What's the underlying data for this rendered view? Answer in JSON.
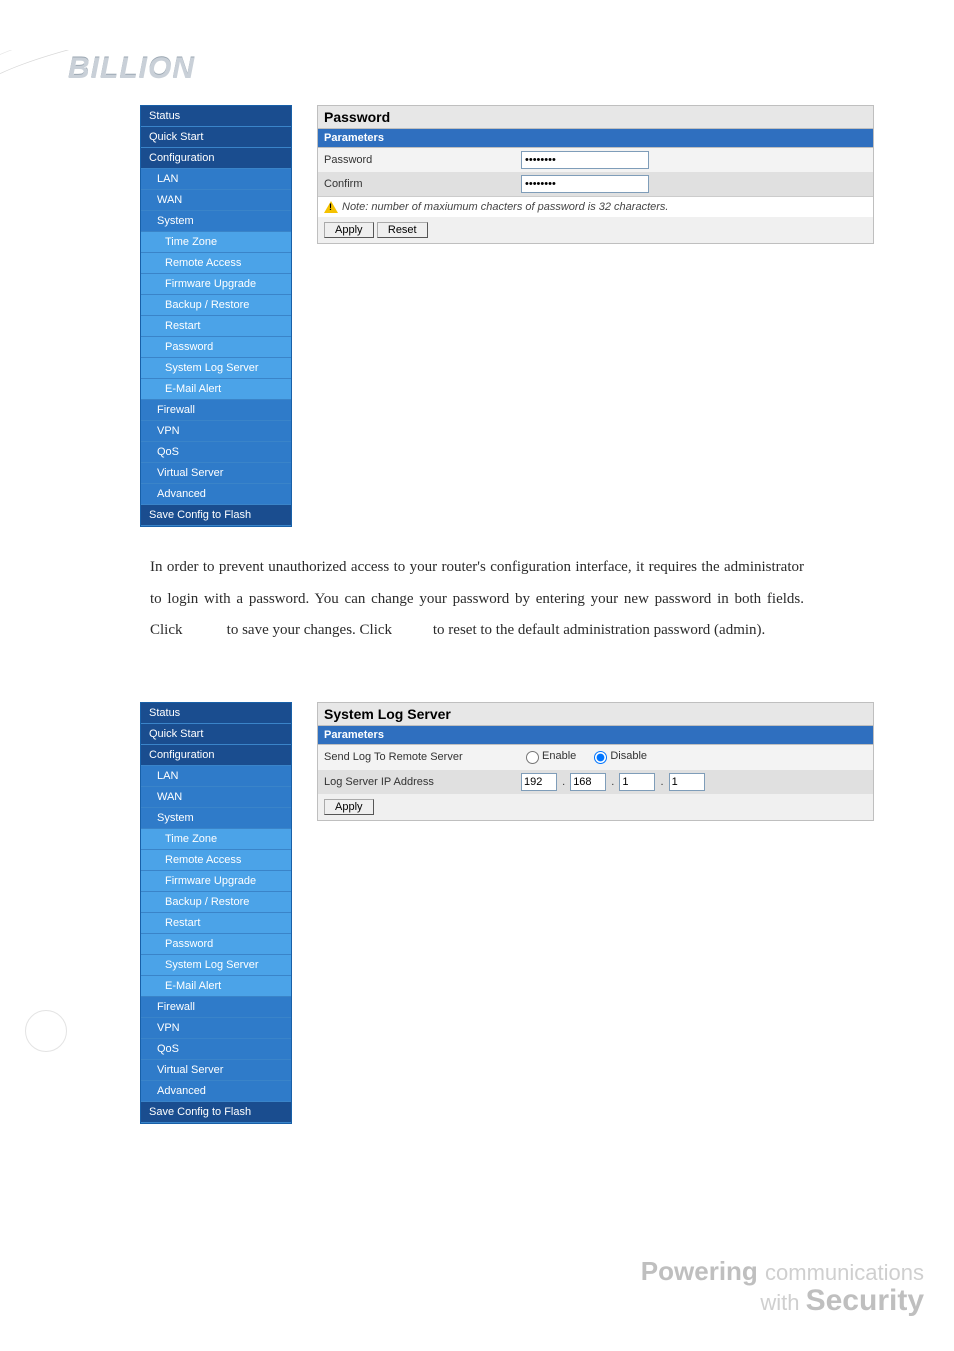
{
  "logo_text": "BILLION",
  "sidebar": {
    "items": [
      {
        "label": "Status",
        "level": 0
      },
      {
        "label": "Quick Start",
        "level": 0
      },
      {
        "label": "Configuration",
        "level": 0
      },
      {
        "label": "LAN",
        "level": 1
      },
      {
        "label": "WAN",
        "level": 1
      },
      {
        "label": "System",
        "level": 1
      },
      {
        "label": "Time Zone",
        "level": 2
      },
      {
        "label": "Remote Access",
        "level": 2
      },
      {
        "label": "Firmware Upgrade",
        "level": 2
      },
      {
        "label": "Backup / Restore",
        "level": 2
      },
      {
        "label": "Restart",
        "level": 2
      },
      {
        "label": "Password",
        "level": 2
      },
      {
        "label": "System Log Server",
        "level": 2
      },
      {
        "label": "E-Mail Alert",
        "level": 2
      },
      {
        "label": "Firewall",
        "level": 1
      },
      {
        "label": "VPN",
        "level": 1
      },
      {
        "label": "QoS",
        "level": 1
      },
      {
        "label": "Virtual Server",
        "level": 1
      },
      {
        "label": "Advanced",
        "level": 1
      },
      {
        "label": "Save Config to Flash",
        "level": 0
      }
    ]
  },
  "password_pane": {
    "title": "Password",
    "parameters_header": "Parameters",
    "rows": {
      "password_label": "Password",
      "password_value": "••••••••",
      "confirm_label": "Confirm",
      "confirm_value": "••••••••"
    },
    "note": "Note: number of maxiumum chacters of password is 32 characters.",
    "apply_label": "Apply",
    "reset_label": "Reset"
  },
  "description_parts": {
    "a": "In order to prevent unauthorized access to your router's configuration interface, it requires the administrator to login with a password. You can change your password by entering your new password in both fields. Click ",
    "b": " to save your changes. Click ",
    "c": " to reset to the default administration password (admin)."
  },
  "syslog_pane": {
    "title": "System Log Server",
    "parameters_header": "Parameters",
    "send_log_label": "Send Log To Remote Server",
    "enable_label": "Enable",
    "disable_label": "Disable",
    "selected": "disable",
    "ip_label": "Log Server IP Address",
    "ip": [
      "192",
      "168",
      "1",
      "1"
    ],
    "apply_label": "Apply"
  },
  "footer": {
    "line1_a": "Powering",
    "line1_b": "communications",
    "line2_a": "with",
    "line2_b": "Security"
  }
}
